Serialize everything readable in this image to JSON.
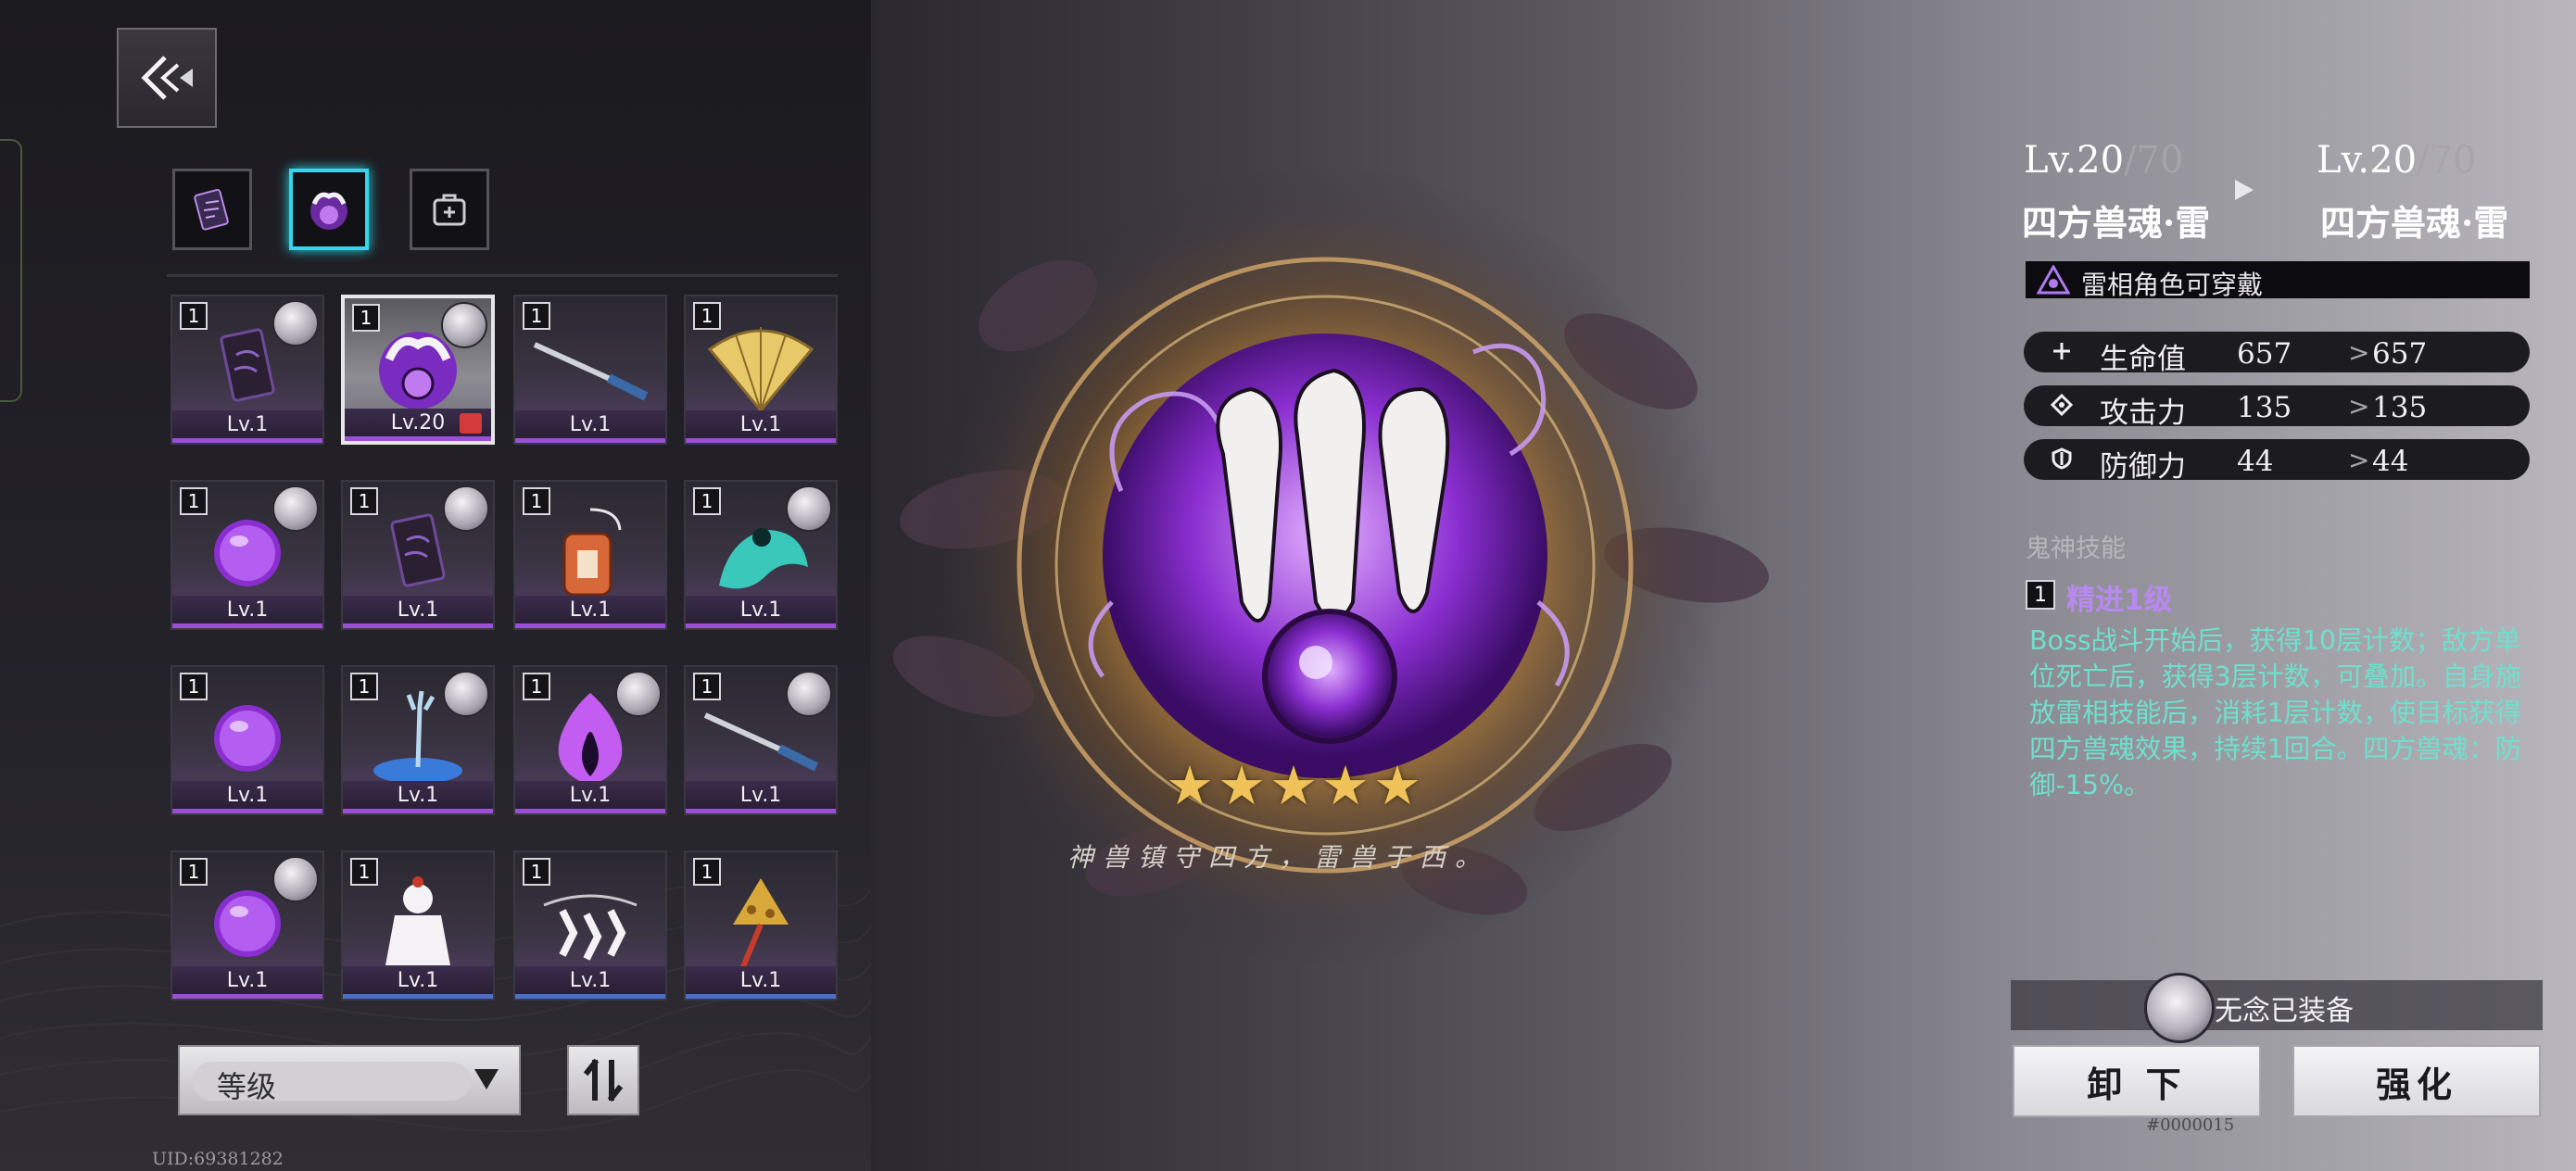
{
  "header": {
    "back_icon": "back-chevron-icon"
  },
  "category_tabs": [
    {
      "icon": "talisman-icon",
      "active": false
    },
    {
      "icon": "beast-soul-icon",
      "active": true
    },
    {
      "icon": "bag-icon",
      "active": false
    }
  ],
  "items": [
    {
      "badge": "1",
      "level": "Lv.1",
      "art": "talisman",
      "avatar": true
    },
    {
      "badge": "1",
      "level": "Lv.20",
      "art": "beast",
      "avatar": true,
      "selected": true,
      "locked": true
    },
    {
      "badge": "1",
      "level": "Lv.1",
      "art": "blade",
      "avatar": false
    },
    {
      "badge": "1",
      "level": "Lv.1",
      "art": "fan",
      "avatar": false
    },
    {
      "badge": "1",
      "level": "Lv.1",
      "art": "orb",
      "avatar": true
    },
    {
      "badge": "1",
      "level": "Lv.1",
      "art": "talisman",
      "avatar": true
    },
    {
      "badge": "1",
      "level": "Lv.1",
      "art": "charm",
      "avatar": false
    },
    {
      "badge": "1",
      "level": "Lv.1",
      "art": "spirit",
      "avatar": true
    },
    {
      "badge": "1",
      "level": "Lv.1",
      "art": "orb",
      "avatar": false
    },
    {
      "badge": "1",
      "level": "Lv.1",
      "art": "hand",
      "avatar": true
    },
    {
      "badge": "1",
      "level": "Lv.1",
      "art": "flame",
      "avatar": true
    },
    {
      "badge": "1",
      "level": "Lv.1",
      "art": "blade",
      "avatar": true
    },
    {
      "badge": "1",
      "level": "Lv.1",
      "art": "orb",
      "avatar": true
    },
    {
      "badge": "1",
      "level": "Lv.1",
      "art": "doll",
      "avatar": false,
      "blue": true
    },
    {
      "badge": "1",
      "level": "Lv.1",
      "art": "paper",
      "avatar": false,
      "blue": true
    },
    {
      "badge": "1",
      "level": "Lv.1",
      "art": "bell",
      "avatar": false,
      "blue": true
    }
  ],
  "sort": {
    "label": "等级",
    "order_icon": "sort-order-icon"
  },
  "uid": "UID:69381282",
  "center": {
    "stars": 5,
    "flavor_text": "神兽镇守四方，雷兽于西。"
  },
  "detail": {
    "current": {
      "level": "Lv.20",
      "max": "/70",
      "name": "四方兽魂·雷"
    },
    "next": {
      "level": "Lv.20",
      "max": "/70",
      "name": "四方兽魂·雷"
    },
    "element_note": "雷相角色可穿戴",
    "stats": [
      {
        "icon": "plus-icon",
        "label": "生命值",
        "current": "657",
        "next": "657"
      },
      {
        "icon": "attack-icon",
        "label": "攻击力",
        "current": "135",
        "next": "135"
      },
      {
        "icon": "shield-icon",
        "label": "防御力",
        "current": "44",
        "next": "44"
      }
    ],
    "skill_header": "鬼神技能",
    "skill_level_badge": "1",
    "skill_name": "精进1级",
    "skill_desc": "Boss战斗开始后，获得10层计数；敌方单位死亡后，获得3层计数，可叠加。自身施放雷相技能后，消耗1层计数，使目标获得四方兽魂效果，持续1回合。四方兽魂：防御-15%。"
  },
  "equipped": {
    "label": "无念已装备"
  },
  "actions": {
    "unequip": "卸 下",
    "enhance": "强化"
  },
  "serial": "#0000015",
  "colors": {
    "accent_cyan": "#2fd8ea",
    "rarity_purple": "#9a4fd6",
    "rarity_blue": "#4a6fc9",
    "skill_name": "#b889f2",
    "skill_desc": "#6fe0cd",
    "star": "#f0c25a"
  }
}
